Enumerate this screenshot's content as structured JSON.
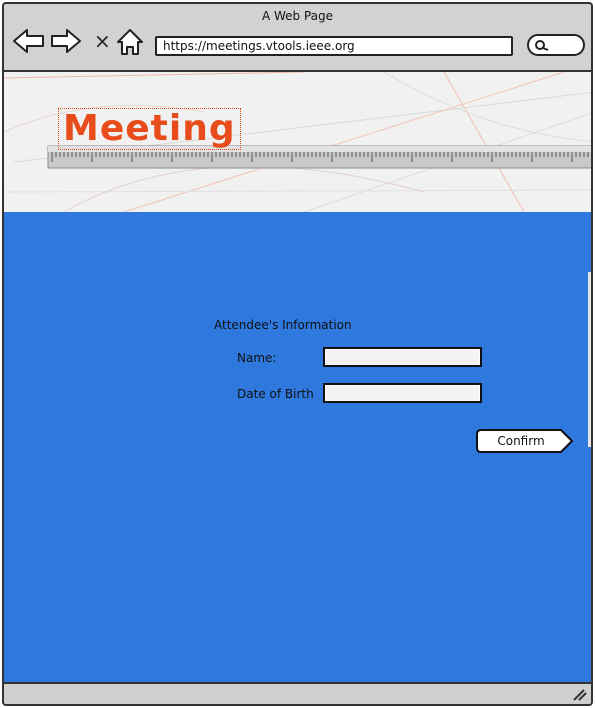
{
  "window": {
    "title": "A Web Page"
  },
  "browser": {
    "url": "https://meetings.vtools.ieee.org",
    "icons": {
      "back": "back-arrow-icon",
      "forward": "forward-arrow-icon",
      "stop": "close-icon",
      "home": "home-icon",
      "search": "search-icon",
      "resize": "resize-grip-icon"
    }
  },
  "banner": {
    "logo_text": "Meeting"
  },
  "form": {
    "heading": "Attendee's Information",
    "name_label": "Name:",
    "name_value": "",
    "dob_label": "Date of Birth",
    "dob_value": "",
    "confirm_label": "Confirm"
  },
  "colors": {
    "content_background": "#2e78de",
    "logo_orange": "#e84c1a",
    "chrome_gray": "#d2d2d2"
  }
}
